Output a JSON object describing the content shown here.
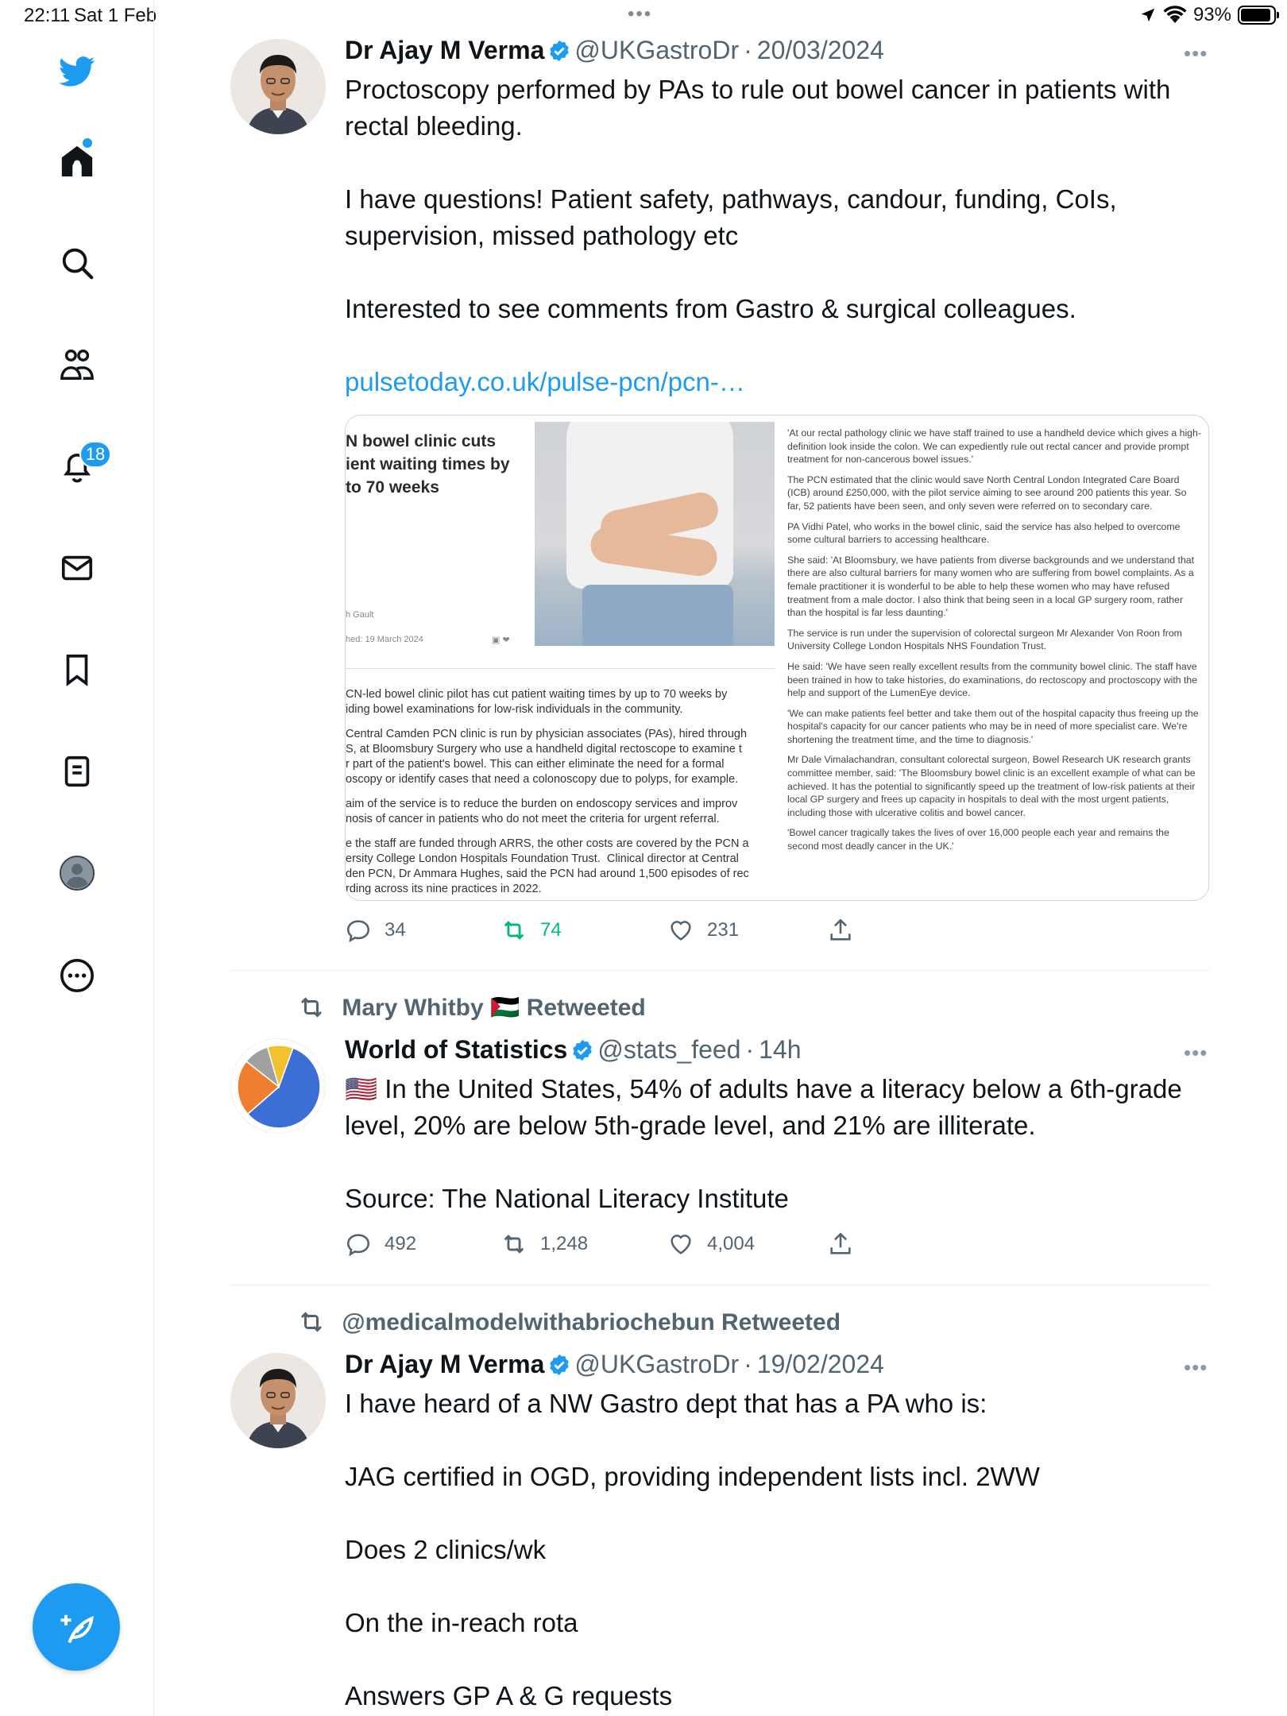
{
  "status_bar": {
    "time": "22:11",
    "date": "Sat 1 Feb",
    "battery": "93%",
    "battery_level": 0.93
  },
  "sidebar": {
    "notifications_badge": "18",
    "items": [
      "twitter-logo-icon",
      "home-icon",
      "search-icon",
      "communities-icon",
      "notifications-icon",
      "messages-icon",
      "bookmarks-icon",
      "lists-icon",
      "profile-icon",
      "more-icon"
    ]
  },
  "tweets": [
    {
      "name": "Dr Ajay M Verma",
      "handle": "@UKGastroDr",
      "separator": "·",
      "date": "20/03/2024",
      "text": "Proctoscopy performed by PAs to rule out bowel cancer in patients with rectal bleeding.\n\nI have questions! Patient safety, pathways, candour, funding, CoIs, supervision, missed pathology etc\n\nInterested to see comments from Gastro & surgical colleagues.\n\n",
      "link": "pulsetoday.co.uk/pulse-pcn/pcn-…",
      "replies": "34",
      "retweets": "74",
      "likes": "231",
      "card": {
        "headline": "N bowel clinic cuts\nient waiting times by\nto 70 weeks",
        "author": "h Gault",
        "published": "hed: 19 March 2024",
        "left_paragraphs": [
          "CN-led bowel clinic pilot has cut patient waiting times by up to 70 weeks by\niding bowel examinations for low-risk individuals in the community.",
          "Central Camden PCN clinic is run by physician associates (PAs), hired through\nS, at Bloomsbury Surgery who use a handheld digital rectoscope to examine t\nr part of the patient's bowel. This can either eliminate the need for a formal\noscopy or identify cases that need a colonoscopy due to polyps, for example.",
          "aim of the service is to reduce the burden on endoscopy services and improv\nnosis of cancer in patients who do not meet the criteria for urgent referral.",
          "e the staff are funded through ARRS, the other costs are covered by the PCN a\nersity College London Hospitals Foundation Trust.  Clinical director at Central\nden PCN, Dr Ammara Hughes, said the PCN had around 1,500 episodes of rec\nrding across its nine practices in 2022."
        ],
        "right_paragraphs": [
          "'At our rectal pathology clinic we have staff trained to use a handheld device which gives a high-definition look inside the colon. We can expediently rule out rectal cancer and provide prompt treatment for non-cancerous bowel issues.'",
          "The PCN estimated that the clinic would save North Central London Integrated Care Board (ICB) around £250,000, with the pilot service aiming to see around 200 patients this year. So far, 52 patients have been seen, and only seven were referred on to secondary care.",
          "PA Vidhi Patel, who works in the bowel clinic, said the service has also helped to overcome some cultural barriers to accessing healthcare.",
          "She said: 'At Bloomsbury, we have patients from diverse backgrounds and we understand that there are also cultural barriers for many women who are suffering from bowel complaints. As a female practitioner it is wonderful to be able to help these women who may have refused treatment from a male doctor. I also think that being seen in a local GP surgery room, rather than the hospital is far less daunting.'",
          "The service is run under the supervision of colorectal surgeon Mr Alexander Von Roon from University College London Hospitals NHS Foundation Trust.",
          "He said: 'We have seen really excellent results from the community bowel clinic. The staff have been trained in how to take histories, do examinations, do rectoscopy and proctoscopy with the help and support of the LumenEye device.",
          "'We can make patients feel better and take them out of the hospital capacity thus freeing up the hospital's capacity for our cancer patients who may be in need of more specialist care. We're shortening the treatment time, and the time to diagnosis.'",
          "Mr Dale Vimalachandran, consultant colorectal surgeon, Bowel Research UK research grants committee member, said: 'The Bloomsbury bowel clinic is an excellent example of what can be achieved. It has the potential to significantly speed up the treatment of low-risk patients at their local GP surgery and frees up capacity in hospitals to deal with the most urgent patients, including those with ulcerative colitis and bowel cancer.",
          "'Bowel cancer tragically takes the lives of over 16,000 people each year and remains the second most deadly cancer in the UK.'"
        ]
      }
    },
    {
      "retweeted_by": "Mary Whitby 🇵🇸 Retweeted",
      "name": "World of Statistics",
      "handle": "@stats_feed",
      "separator": "·",
      "date": "14h",
      "text": "🇺🇸 In the United States, 54% of adults have a literacy below a 6th-grade level, 20% are below 5th-grade level, and 21% are illiterate.\n\nSource: The National Literacy Institute",
      "replies": "492",
      "retweets": "1,248",
      "likes": "4,004",
      "avatar_colors": [
        "#3b6fd4",
        "#ef7f2e",
        "#a0a0a0",
        "#f2c12e"
      ]
    },
    {
      "retweeted_by": "@medicalmodelwithabriochebun Retweeted",
      "name": "Dr Ajay M Verma",
      "handle": "@UKGastroDr",
      "separator": "·",
      "date": "19/02/2024",
      "text": "I have heard of a NW Gastro dept that has a PA who is:\n\nJAG certified in OGD, providing independent lists incl. 2WW\n\nDoes 2 clinics/wk\n\nOn the in-reach rota\n\nAnswers GP A & G requests"
    }
  ],
  "colors": {
    "accent": "#1d9bf0",
    "retweet_green": "#00ba7c",
    "secondary_text": "#536471"
  }
}
